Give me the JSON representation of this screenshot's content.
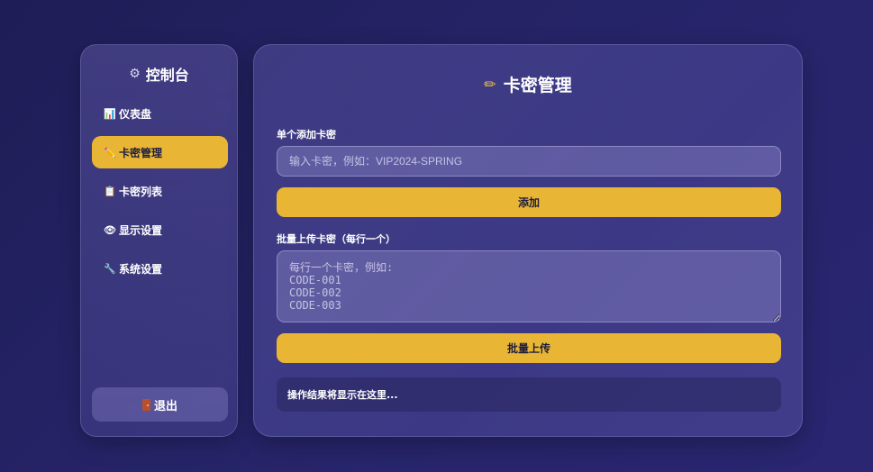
{
  "sidebar": {
    "brand": {
      "icon": "gear-icon",
      "title": "控制台"
    },
    "items": [
      {
        "icon": "bar-chart-icon",
        "glyph": "📊",
        "label": "仪表盘",
        "active": false
      },
      {
        "icon": "pencil-icon",
        "glyph": "✏️",
        "label": "卡密管理",
        "active": true
      },
      {
        "icon": "clipboard-icon",
        "glyph": "📋",
        "label": "卡密列表",
        "active": false
      },
      {
        "icon": "eye-icon",
        "glyph": "👁",
        "label": "显示设置",
        "active": false
      },
      {
        "icon": "wrench-icon",
        "glyph": "🔧",
        "label": "系统设置",
        "active": false
      }
    ],
    "logout": {
      "icon": "door-icon",
      "label": "退出"
    }
  },
  "main": {
    "title": "卡密管理",
    "title_icon": "pencil-icon",
    "single": {
      "label": "单个添加卡密",
      "placeholder": "输入卡密，例如：VIP2024-SPRING",
      "value": "",
      "button": "添加"
    },
    "batch": {
      "label": "批量上传卡密（每行一个）",
      "placeholder": "每行一个卡密，例如:\nCODE-001\nCODE-002\nCODE-003",
      "value": "",
      "button": "批量上传"
    },
    "result": "操作结果将显示在这里..."
  },
  "colors": {
    "accent": "#e8b634",
    "background": "#262468",
    "panel": "#5e59ad",
    "result_bg": "#28265f"
  }
}
